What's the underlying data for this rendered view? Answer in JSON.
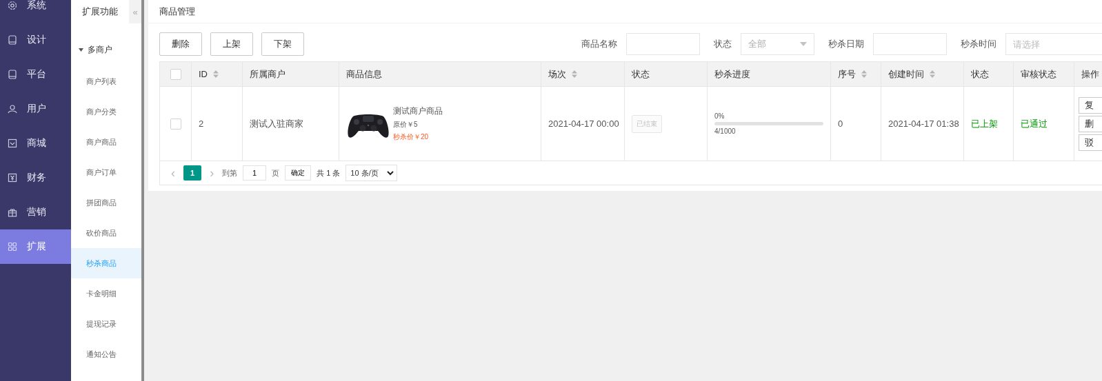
{
  "nav": {
    "items": [
      {
        "label": "系统",
        "selected": false
      },
      {
        "label": "设计",
        "selected": false
      },
      {
        "label": "平台",
        "selected": false
      },
      {
        "label": "用户",
        "selected": false
      },
      {
        "label": "商城",
        "selected": false
      },
      {
        "label": "财务",
        "selected": false
      },
      {
        "label": "营销",
        "selected": false
      },
      {
        "label": "扩展",
        "selected": true
      }
    ]
  },
  "submenu": {
    "title": "扩展功能",
    "collapse": "«",
    "group": {
      "label": "多商户",
      "expanded": true
    },
    "items": [
      {
        "label": "商户列表",
        "selected": false
      },
      {
        "label": "商户分类",
        "selected": false
      },
      {
        "label": "商户商品",
        "selected": false
      },
      {
        "label": "商户订单",
        "selected": false
      },
      {
        "label": "拼团商品",
        "selected": false
      },
      {
        "label": "砍价商品",
        "selected": false
      },
      {
        "label": "秒杀商品",
        "selected": true
      },
      {
        "label": "卡金明细",
        "selected": false
      },
      {
        "label": "提现记录",
        "selected": false
      },
      {
        "label": "通知公告",
        "selected": false
      }
    ]
  },
  "panel": {
    "title": "商品管理",
    "buttons": [
      "删除",
      "上架",
      "下架"
    ],
    "filters": [
      {
        "kind": "input",
        "label": "商品名称"
      },
      {
        "kind": "select",
        "label": "状态",
        "value": "全部"
      },
      {
        "kind": "input",
        "label": "秒杀日期"
      },
      {
        "kind": "input",
        "label": "秒杀时间",
        "placeholder": "请选择"
      }
    ],
    "table": {
      "columns": [
        {
          "kind": "checkbox",
          "checked": false
        },
        {
          "label": "ID",
          "sortable": true
        },
        {
          "label": "所属商户",
          "sortable": false
        },
        {
          "label": "商品信息",
          "sortable": false
        },
        {
          "label": "场次",
          "sortable": true
        },
        {
          "label": "状态",
          "sortable": false
        },
        {
          "label": "秒杀进度",
          "sortable": false
        },
        {
          "label": "序号",
          "sortable": true
        },
        {
          "label": "创建时间",
          "sortable": true
        },
        {
          "label": "状态",
          "sortable": false
        },
        {
          "label": "审核状态",
          "sortable": false
        },
        {
          "label": "操作"
        }
      ],
      "rows": [
        {
          "checked": false,
          "id": "2",
          "merchant": "测试入驻商家",
          "product": {
            "kind": "picture",
            "name": "测试商户商品",
            "original_price": "原价￥5",
            "flash_price": "秒杀价￥20"
          },
          "session": "2021-04-17 00:00",
          "status_button": {
            "label": "已结束",
            "disabled": true
          },
          "progress": {
            "percent": "0%",
            "level": 0,
            "count": "4/1000"
          },
          "sort_no": "0",
          "created": "2021-04-17 01:38",
          "shelf_status": "已上架",
          "review_status": "已通过",
          "actions": [
            "复",
            "删",
            "驳"
          ]
        }
      ]
    },
    "pagination": {
      "prev": "‹",
      "pages": [
        {
          "label": "1",
          "selected": true
        }
      ],
      "next": "›",
      "goto_label": "到第",
      "goto_value": "1",
      "page_unit": "页",
      "confirm": "确定",
      "total": "共 1 条",
      "page_size": "10 条/页"
    }
  }
}
